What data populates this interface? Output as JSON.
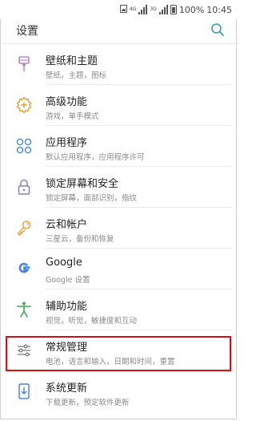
{
  "status_bar": {
    "net_1": "4G",
    "net_2": "3G",
    "battery_pct": "100%",
    "time": "10:45"
  },
  "header": {
    "title": "设置"
  },
  "items": [
    {
      "label": "壁纸和主题",
      "sub": "壁纸，主题，图标",
      "icon": "brush-icon",
      "color": "#b48bd1"
    },
    {
      "label": "高级功能",
      "sub": "游戏，单手模式",
      "icon": "gear-plus-icon",
      "color": "#e3a33b"
    },
    {
      "label": "应用程序",
      "sub": "默认应用程序，应用程序许可",
      "icon": "apps-grid-icon",
      "color": "#4f8fd8"
    },
    {
      "label": "锁定屏幕和安全",
      "sub": "锁定屏幕，面部识别，指纹",
      "icon": "lock-icon",
      "color": "#8a7fb8"
    },
    {
      "label": "云和帐户",
      "sub": "三星云，备份和恢复",
      "icon": "key-icon",
      "color": "#e6a24a"
    },
    {
      "label": "Google",
      "sub": "Google 设置",
      "icon": "google-icon",
      "color": "#4a86d8"
    },
    {
      "label": "辅助功能",
      "sub": "视觉，听觉，敏捷度和互动",
      "icon": "accessibility-icon",
      "color": "#3fa653"
    },
    {
      "label": "常规管理",
      "sub": "电池，语言和输入，日期和时间，重置",
      "icon": "sliders-icon",
      "color": "#7c7c7c"
    },
    {
      "label": "系统更新",
      "sub": "下载更新，预定软件更新",
      "icon": "system-update-icon",
      "color": "#4a86d8"
    }
  ],
  "highlight_color": "#d40f14"
}
